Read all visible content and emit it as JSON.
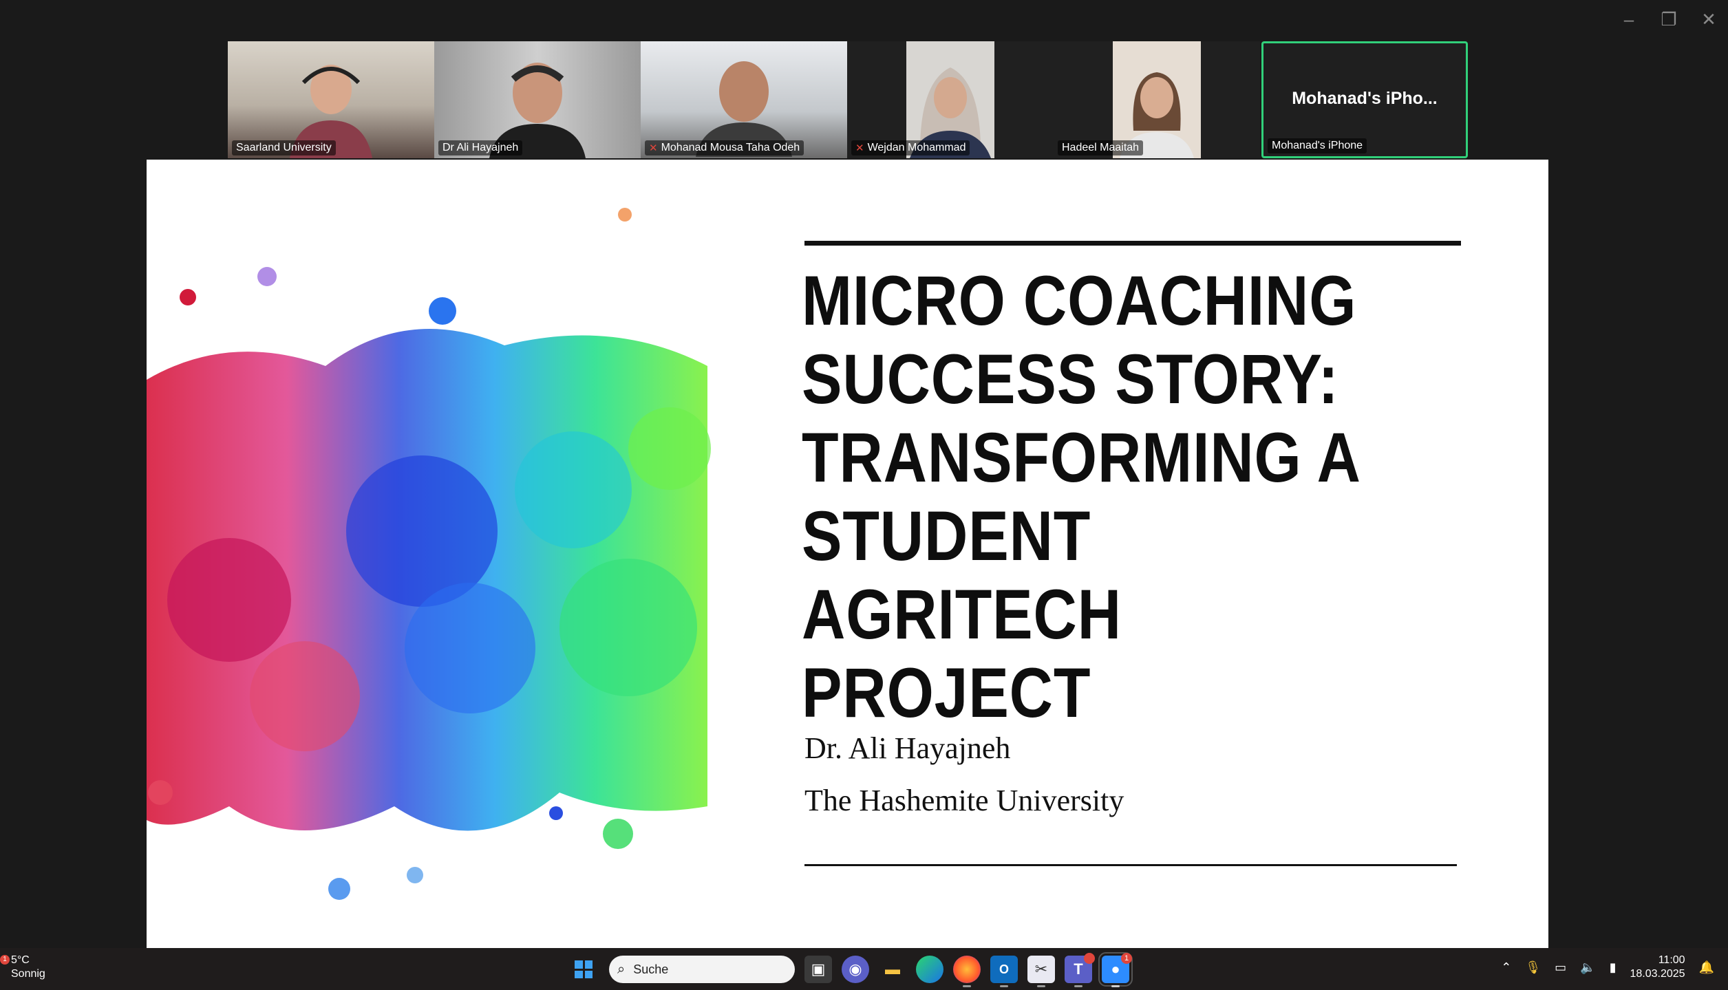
{
  "window_controls": {
    "minimize": "–",
    "restore": "❐",
    "close": "✕"
  },
  "participants": [
    {
      "name": "Saarland University",
      "muted": false
    },
    {
      "name": "Dr Ali Hayajneh",
      "muted": false
    },
    {
      "name": "Mohanad Mousa Taha Odeh",
      "muted": true
    },
    {
      "name": "Wejdan Mohammad",
      "muted": true
    },
    {
      "name": "Hadeel Maaitah",
      "muted": false
    }
  ],
  "active_speaker": {
    "display": "Mohanad's iPho...",
    "name": "Mohanad's iPhone",
    "border_color": "#31d07a"
  },
  "slide": {
    "title_lines": [
      "MICRO COACHING",
      "SUCCESS STORY:",
      "TRANSFORMING A",
      "STUDENT AGRITECH",
      "PROJECT"
    ],
    "author": "Dr. Ali Hayajneh",
    "institution": "The Hashemite University"
  },
  "taskbar": {
    "weather_temp": "5°C",
    "weather_desc": "Sonnig",
    "weather_badge": "1",
    "search_placeholder": "Suche",
    "zoom_badge": "1",
    "time": "11:00",
    "date": "18.03.2025"
  },
  "icons": {
    "start": "windows-start-icon",
    "search": "search-icon",
    "task_view": "task-view-icon",
    "meet": "video-chat-icon",
    "explorer": "folder-icon",
    "edge": "edge-browser-icon",
    "firefox": "firefox-icon",
    "outlook": "outlook-icon",
    "snipping": "snipping-tool-icon",
    "teams": "teams-icon",
    "zoom": "zoom-icon"
  }
}
